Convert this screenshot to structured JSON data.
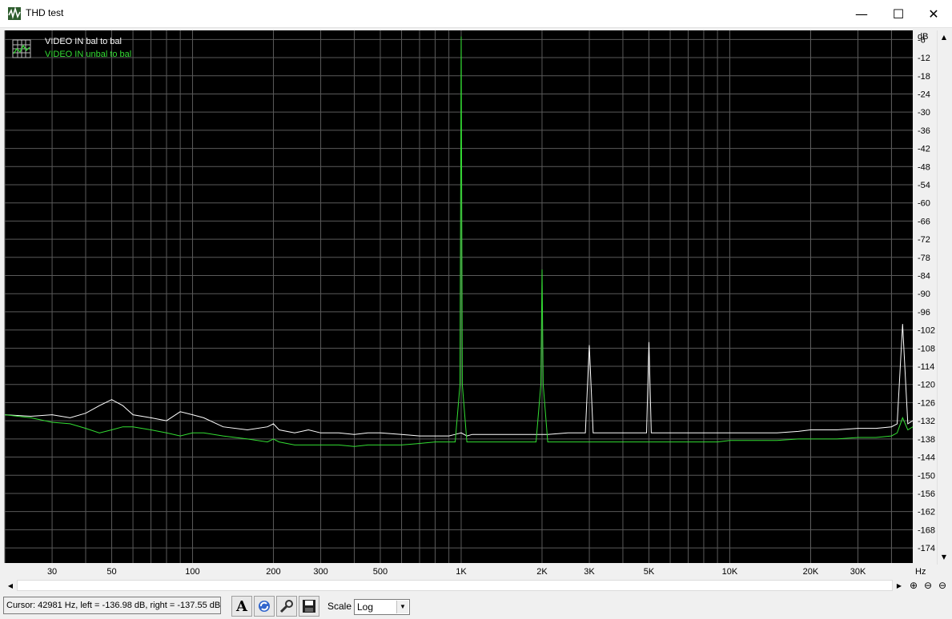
{
  "window": {
    "title": "THD test",
    "minimize_glyph": "—",
    "maximize_glyph": "☐",
    "close_glyph": "✕"
  },
  "legend": {
    "series1": "VIDEO IN bal to bal",
    "series2": "VIDEO IN unbal  to bal"
  },
  "axis": {
    "y_unit": "dB",
    "x_unit": "Hz"
  },
  "chart_data": {
    "type": "line",
    "xscale": "log",
    "xlim": [
      20,
      48000
    ],
    "ylim": [
      -179,
      -3
    ],
    "y_ticks": [
      -6,
      -12,
      -18,
      -24,
      -30,
      -36,
      -42,
      -48,
      -54,
      -60,
      -66,
      -72,
      -78,
      -84,
      -90,
      -96,
      -102,
      -108,
      -114,
      -120,
      -126,
      -132,
      -138,
      -144,
      -150,
      -156,
      -162,
      -168,
      -174
    ],
    "x_ticks": [
      {
        "v": 30,
        "label": "30"
      },
      {
        "v": 50,
        "label": "50"
      },
      {
        "v": 100,
        "label": "100"
      },
      {
        "v": 200,
        "label": "200"
      },
      {
        "v": 300,
        "label": "300"
      },
      {
        "v": 500,
        "label": "500"
      },
      {
        "v": 1000,
        "label": "1K"
      },
      {
        "v": 2000,
        "label": "2K"
      },
      {
        "v": 3000,
        "label": "3K"
      },
      {
        "v": 5000,
        "label": "5K"
      },
      {
        "v": 10000,
        "label": "10K"
      },
      {
        "v": 20000,
        "label": "20K"
      },
      {
        "v": 30000,
        "label": "30K"
      }
    ],
    "grid": true,
    "legend_position": "top-left",
    "series": [
      {
        "name": "VIDEO IN bal to bal",
        "color": "#ffffff",
        "x": [
          20,
          25,
          30,
          35,
          40,
          45,
          50,
          55,
          60,
          70,
          80,
          90,
          100,
          110,
          130,
          160,
          190,
          200,
          210,
          240,
          270,
          300,
          350,
          400,
          450,
          500,
          600,
          700,
          800,
          900,
          950,
          1000,
          1050,
          1100,
          1200,
          1500,
          1900,
          2000,
          2100,
          2500,
          2900,
          3000,
          3100,
          4000,
          4900,
          5000,
          5100,
          6000,
          7000,
          8000,
          9000,
          10000,
          12000,
          15000,
          18000,
          20000,
          25000,
          30000,
          35000,
          40000,
          42000,
          44000,
          46000,
          48000
        ],
        "values": [
          -130,
          -130.5,
          -130,
          -131,
          -129.5,
          -127,
          -125,
          -127,
          -130,
          -131,
          -132,
          -129,
          -130,
          -131,
          -134,
          -135,
          -134,
          -133,
          -135,
          -136,
          -135,
          -136,
          -136,
          -136.5,
          -136,
          -136,
          -136.5,
          -137,
          -137,
          -137,
          -136.5,
          -136,
          -137,
          -136.5,
          -136.5,
          -136.5,
          -136.5,
          -136.5,
          -136.5,
          -136,
          -136,
          -107,
          -136,
          -136,
          -136,
          -106,
          -136,
          -136,
          -136,
          -136,
          -136,
          -136,
          -136,
          -136,
          -135.5,
          -135,
          -135,
          -134.5,
          -134.5,
          -134,
          -133,
          -100,
          -133,
          -132
        ]
      },
      {
        "name": "VIDEO IN unbal  to bal",
        "color": "#33dd33",
        "x": [
          20,
          25,
          30,
          35,
          40,
          45,
          50,
          55,
          60,
          70,
          80,
          90,
          100,
          110,
          130,
          160,
          190,
          200,
          210,
          240,
          270,
          300,
          350,
          400,
          450,
          500,
          600,
          700,
          800,
          900,
          950,
          990,
          1000,
          1010,
          1050,
          1100,
          1200,
          1500,
          1900,
          1980,
          2000,
          2020,
          2100,
          2500,
          2900,
          3000,
          3100,
          4000,
          4900,
          5000,
          5100,
          6000,
          7000,
          8000,
          9000,
          10000,
          12000,
          15000,
          18000,
          20000,
          25000,
          30000,
          35000,
          40000,
          42000,
          44000,
          46000,
          48000
        ],
        "values": [
          -130,
          -131,
          -132.5,
          -133,
          -134.5,
          -136,
          -135,
          -134,
          -134,
          -135,
          -136,
          -137,
          -136,
          -136,
          -137,
          -138,
          -139,
          -138,
          -139,
          -140,
          -140,
          -140,
          -140,
          -140.5,
          -140,
          -140,
          -140,
          -139.5,
          -139,
          -139,
          -139,
          -120,
          -5,
          -120,
          -139,
          -139,
          -139,
          -139,
          -139,
          -120,
          -82,
          -120,
          -139,
          -139,
          -139,
          -139,
          -139,
          -139,
          -139,
          -139,
          -139,
          -139,
          -139,
          -139,
          -139,
          -138.5,
          -138.5,
          -138.5,
          -138,
          -138,
          -138,
          -137.5,
          -137.5,
          -137,
          -136,
          -131,
          -135,
          -134
        ]
      }
    ]
  },
  "statusbar": {
    "cursor_text": "Cursor:  42981 Hz,  left = -136.98 dB,  right = -137.55 dB",
    "scale_label": "Scale",
    "scale_value": "Log",
    "font_button_glyph": "A"
  }
}
